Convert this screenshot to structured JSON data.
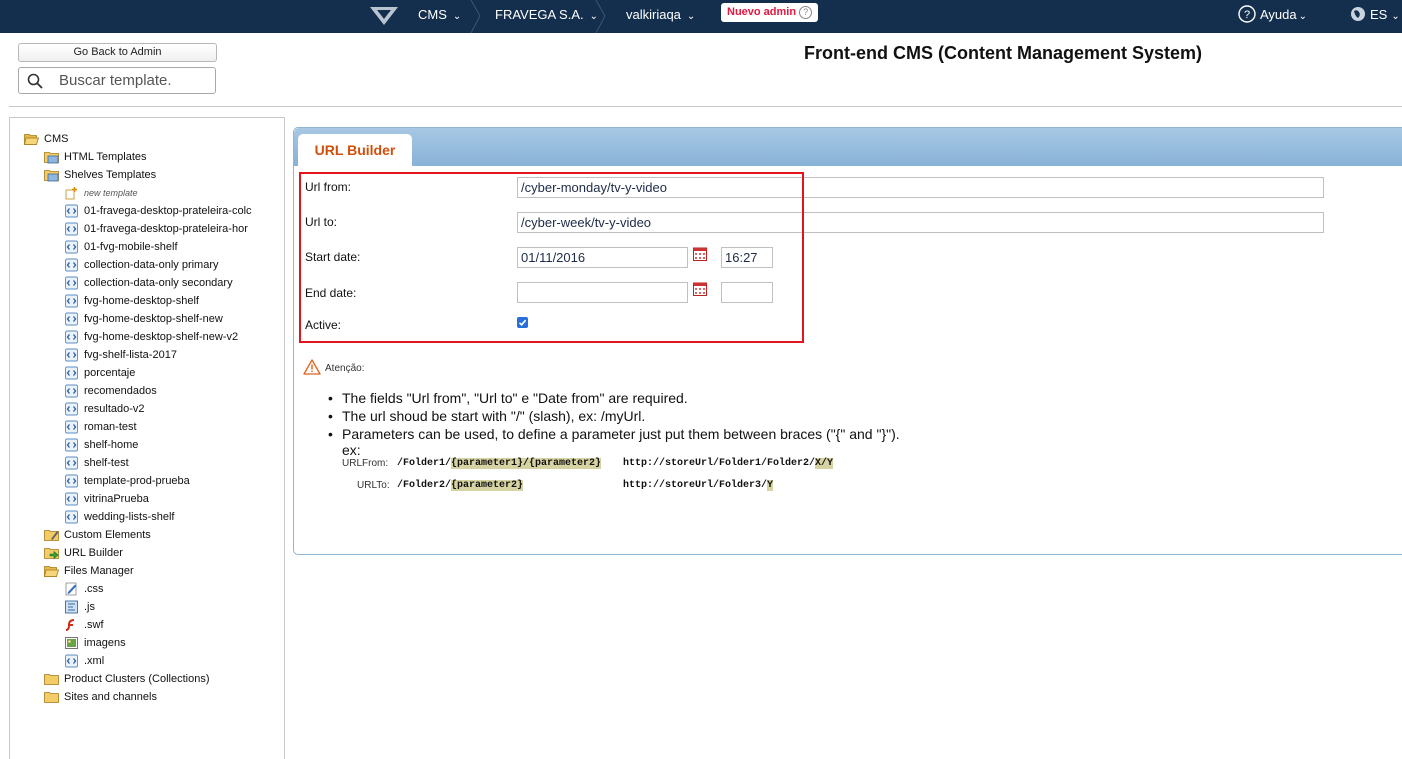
{
  "topbar": {
    "module": "CMS",
    "account": "FRAVEGA S.A.",
    "workspace": "valkiriaqa",
    "badge": "Nuevo admin",
    "badge_help": "?",
    "help": "Ayuda",
    "language": "ES"
  },
  "header": {
    "back_button": "Go Back to Admin",
    "search_placeholder": "Buscar template.",
    "title": "Front-end CMS (Content Management System)"
  },
  "tree": {
    "root": "CMS",
    "html_templates": "HTML Templates",
    "shelves_templates": "Shelves Templates",
    "new_template": "new template",
    "shelves": [
      "01-fravega-desktop-prateleira-colc",
      "01-fravega-desktop-prateleira-hor",
      "01-fvg-mobile-shelf",
      "collection-data-only primary",
      "collection-data-only secondary",
      "fvg-home-desktop-shelf",
      "fvg-home-desktop-shelf-new",
      "fvg-home-desktop-shelf-new-v2",
      "fvg-shelf-lista-2017",
      "porcentaje",
      "recomendados",
      "resultado-v2",
      "roman-test",
      "shelf-home",
      "shelf-test",
      "template-prod-prueba",
      "vitrinaPrueba",
      "wedding-lists-shelf"
    ],
    "custom_elements": "Custom Elements",
    "url_builder": "URL Builder",
    "files_manager": "Files Manager",
    "files": [
      ".css",
      ".js",
      ".swf",
      "imagens",
      ".xml"
    ],
    "product_clusters": "Product Clusters (Collections)",
    "sites_channels": "Sites and channels"
  },
  "panel": {
    "tab": "URL Builder",
    "form": {
      "url_from_label": "Url from:",
      "url_from_value": "/cyber-monday/tv-y-video",
      "url_to_label": "Url to:",
      "url_to_value": "/cyber-week/tv-y-video",
      "start_date_label": "Start date:",
      "start_date_value": "01/11/2016",
      "start_time_value": "16:27",
      "end_date_label": "End date:",
      "end_date_value": "",
      "end_time_value": "",
      "active_label": "Active:",
      "active_checked": true
    },
    "notice": {
      "label": "Atenção:",
      "bullets": [
        "The fields \"Url from\", \"Url to\" e \"Date from\" are required.",
        "The url shoud be start with \"/\" (slash), ex: /myUrl.",
        "Parameters can be used, to define a parameter just put them between braces (\"{\" and \"}\")."
      ],
      "ex_label": "ex:",
      "urlfrom_label": "URLFrom:",
      "urlfrom_folder": "/Folder1/",
      "urlfrom_p1": "{parameter1}",
      "urlfrom_slash": "/",
      "urlfrom_p2": "{parameter2}",
      "urlfrom_result": "http://storeUrl/Folder1/Folder2/",
      "urlfrom_result_hl": "X/Y",
      "urlto_label": "URLTo:",
      "urlto_folder": "/Folder2/",
      "urlto_p2": "{parameter2}",
      "urlto_result": "http://storeUrl/Folder3/",
      "urlto_result_hl": "Y"
    }
  },
  "colors": {
    "topbar": "#142f4e",
    "tab_text": "#d14f0c",
    "highlight_box": "#e3141c",
    "badge_text": "#e4173f"
  }
}
